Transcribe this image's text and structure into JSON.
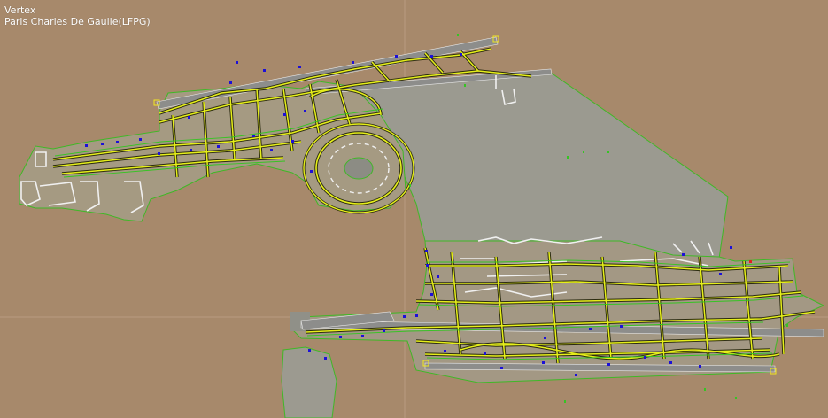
{
  "hud": {
    "tool_name": "Vertex",
    "airport_label": "Paris Charles De Gaulle(LFPG)"
  },
  "colors": {
    "background": "#a7896b",
    "ground_area": "#9b9a90",
    "ground_border": "#3fb826",
    "runway": "#8d8d8b",
    "runway_edge": "#e8e8e8",
    "taxiway_line": "#e6ef1a",
    "taxiway_outline": "#2a2a10",
    "taxiway_border": "#36c423",
    "stand_marker": "#1c10d8",
    "guide_line": "#c8b09a"
  }
}
